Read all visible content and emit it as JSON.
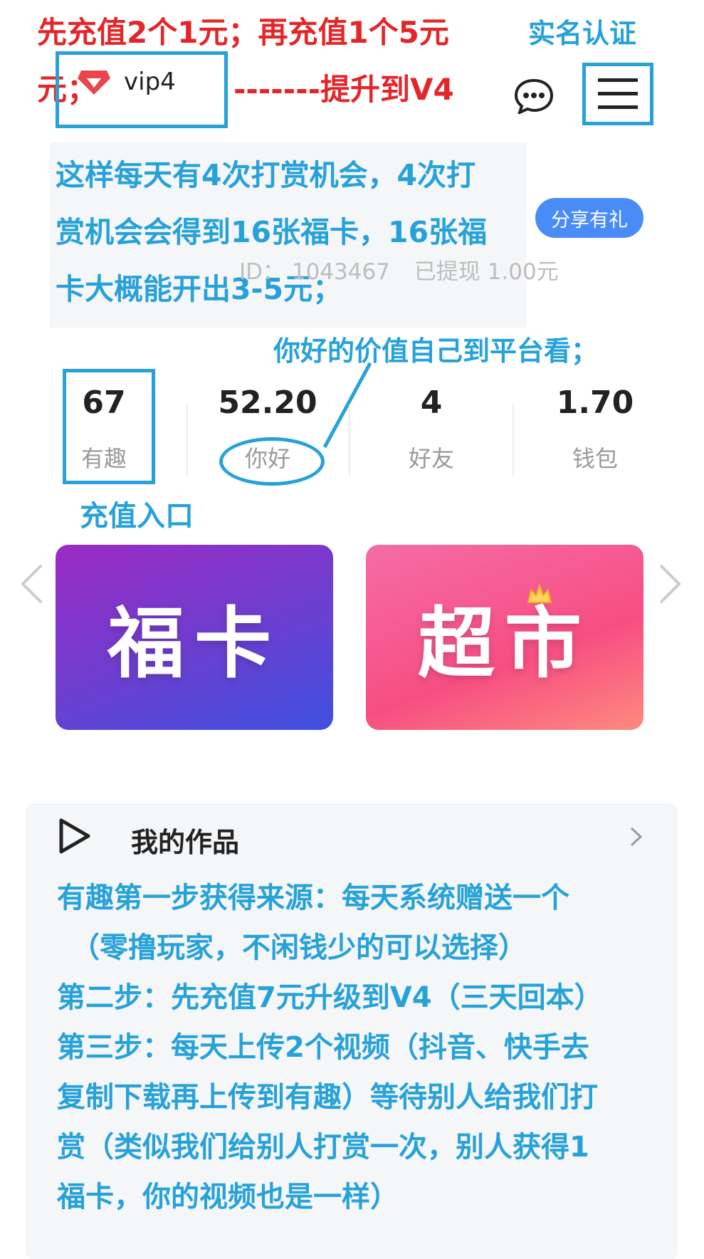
{
  "annotations": {
    "red_line1": "先充值2个1元；再充值1个5元",
    "red_line2": "元；",
    "red_arrow": "-------提升到V4",
    "real_name": "实名认证",
    "tip_line1": "这样每天有4次打赏机会，4次打",
    "tip_line2": "赏机会会得到16张福卡，16张福",
    "tip_line3": "卡大概能开出3-5元；",
    "value_tip": "你好的价值自己到平台看；",
    "recharge_entry": "充值入口"
  },
  "header": {
    "vip_label": "vip4",
    "share_button": "分享有礼",
    "id_label": "ID：",
    "id_value": "1043467",
    "withdrawn": "已提现 1.00元"
  },
  "stats": [
    {
      "value": "67",
      "label": "有趣"
    },
    {
      "value": "52.20",
      "label": "你好"
    },
    {
      "value": "4",
      "label": "好友"
    },
    {
      "value": "1.70",
      "label": "钱包"
    }
  ],
  "cards": {
    "left": "福卡",
    "right": "超市"
  },
  "works": {
    "title": "我的作品"
  },
  "instructions": [
    "有趣第一步获得来源：每天系统赠送一个",
    "（零撸玩家，不闲钱少的可以选择）",
    "第二步：先充值7元升级到V4（三天回本）",
    "第三步：每天上传2个视频（抖音、快手去",
    "复制下载再上传到有趣）等待别人给我们打",
    "赏（类似我们给别人打赏一次，别人获得1",
    "福卡，你的视频也是一样）"
  ],
  "colors": {
    "annotation_red": "#e3262a",
    "annotation_blue": "#27a2d9",
    "share_button": "#4a8cf7"
  },
  "icons": [
    "gem-icon",
    "chat-icon",
    "menu-icon",
    "chevron-left-icon",
    "chevron-right-icon",
    "play-icon",
    "chevron-right-small-icon"
  ]
}
